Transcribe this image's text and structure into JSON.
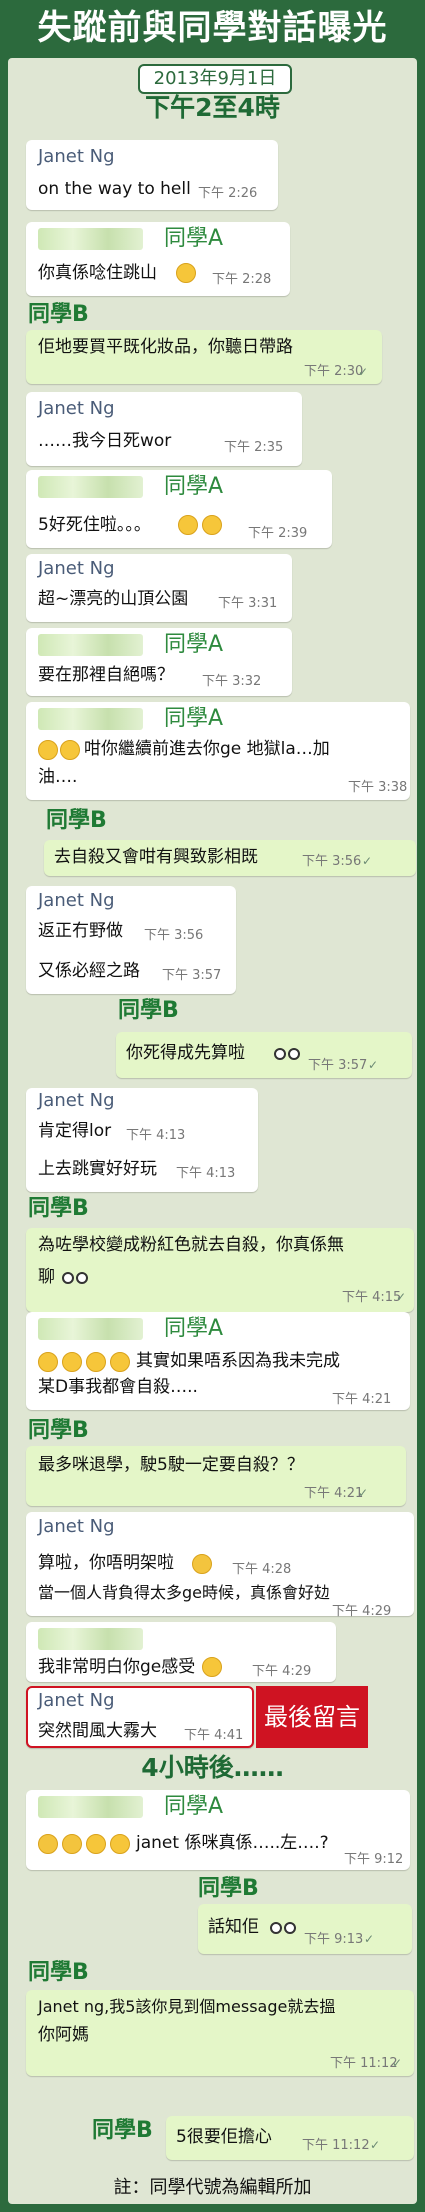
{
  "page_title": "失蹤前與同學對話曝光",
  "date_badge": "2013年9月1日",
  "time_banner": "下午2至4時",
  "later_banner": "4小時後……",
  "footnote": "註：同學代號為編輯所加",
  "last_message_callout": "最後留言",
  "colors": {
    "header_green": "#2c6a3d",
    "panel_bg": "#dfe6d3",
    "outgoing_bubble": "#e4f6c8",
    "callout_red": "#cf1322"
  },
  "names": {
    "janet": "Janet Ng",
    "class_a": "同學A",
    "class_b": "同學B"
  },
  "messages": [
    {
      "text": "on the way to hell",
      "time": "下午 2:26"
    },
    {
      "text": "你真係唸住跳山",
      "time": "下午 2:28"
    },
    {
      "text": "佢地要買平既化妝品，你聽日帶路",
      "time": "下午 2:30"
    },
    {
      "text": "……我今日死wor",
      "time": "下午 2:35"
    },
    {
      "text": "5好死住啦。。。",
      "time": "下午 2:39"
    },
    {
      "text": "超~漂亮的山頂公園",
      "time": "下午 3:31"
    },
    {
      "text": "要在那裡自絕嗎？",
      "time": "下午 3:32"
    },
    {
      "text_line1": "咁你繼續前進去你ge 地獄la…加",
      "text_line2": "油….",
      "time": "下午 3:38"
    },
    {
      "text": "去自殺又會咁有興致影相既",
      "time": "下午 3:56"
    },
    {
      "text": "返正冇野做",
      "time": "下午 3:56"
    },
    {
      "text": "又係必經之路",
      "time": "下午 3:57"
    },
    {
      "text": "你死得成先算啦",
      "time": "下午 3:57"
    },
    {
      "text": "肯定得lor",
      "time": "下午 4:13"
    },
    {
      "text": "上去跳實好好玩",
      "time": "下午 4:13"
    },
    {
      "text_line1": "為咗學校變成粉紅色就去自殺，你真係無",
      "text_line2": "聊",
      "time": "下午 4:15"
    },
    {
      "text_line1": "其實如果唔系因為我未完成",
      "text_line2": "某D事我都會自殺…..",
      "time": "下午 4:21"
    },
    {
      "text": "最多咪退學，駛5駛一定要自殺？？",
      "time": "下午 4:21"
    },
    {
      "text": "算啦，你唔明架啦",
      "time": "下午 4:28"
    },
    {
      "text": "當一個人背負得太多ge時候，真係會好攰",
      "time": "下午 4:29"
    },
    {
      "text": "我非常明白你ge感受",
      "time": "下午 4:29"
    },
    {
      "text": "突然間風大霧大",
      "time": "下午 4:41"
    },
    {
      "text": "janet 係咪真係…..左….?",
      "time": "下午 9:12"
    },
    {
      "text": "話知佢",
      "time": "下午 9:13"
    },
    {
      "text_line1": "Janet ng,我5該你見到個message就去搵",
      "text_line2": "你阿媽",
      "time": "下午 11:12"
    },
    {
      "text": "5很要佢擔心",
      "time": "下午 11:12"
    }
  ]
}
